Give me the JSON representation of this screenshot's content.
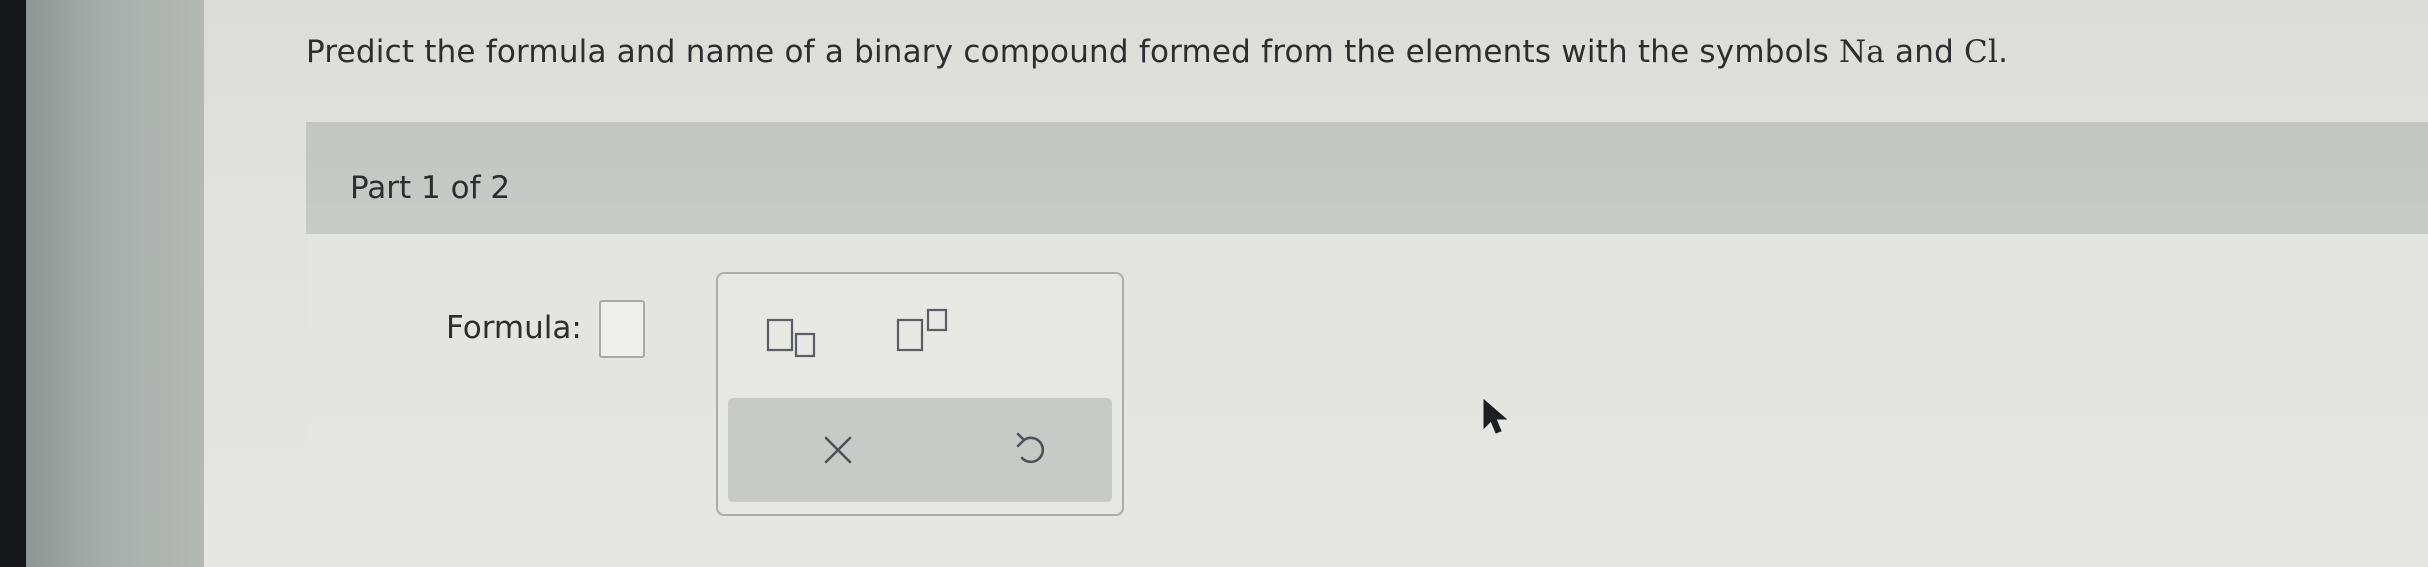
{
  "question": {
    "text_before": "Predict the formula and name of a binary compound formed from the elements with the symbols ",
    "symbol_1": "Na",
    "conjunction": " and ",
    "symbol_2": "Cl",
    "text_after": "."
  },
  "part": {
    "label": "Part 1 of 2"
  },
  "answer": {
    "formula_label": "Formula:",
    "formula_value": ""
  },
  "palette": {
    "buttons": [
      {
        "name": "subscript-icon"
      },
      {
        "name": "superscript-icon"
      },
      {
        "name": "clear-icon",
        "glyph": "×"
      },
      {
        "name": "undo-icon"
      }
    ]
  },
  "colors": {
    "text": "#2c2e30",
    "panel_header": "#c6c8c5",
    "page_background": "#e3e3df",
    "icon": "#5a5e62"
  }
}
